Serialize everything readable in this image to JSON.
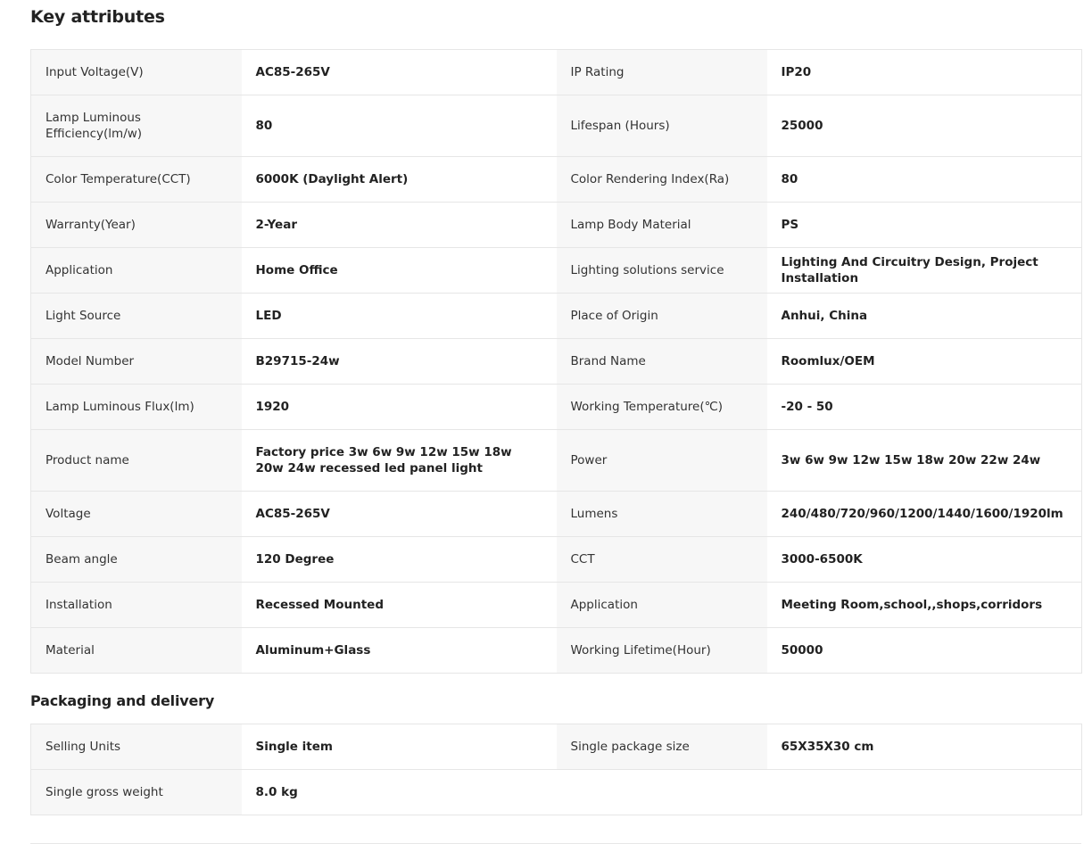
{
  "key_attributes": {
    "title": "Key attributes",
    "rows": [
      [
        {
          "k": "Input Voltage(V)",
          "v": "AC85-265V"
        },
        {
          "k": "IP Rating",
          "v": "IP20"
        }
      ],
      [
        {
          "k": "Lamp Luminous Efficiency(lm/w)",
          "v": "80"
        },
        {
          "k": "Lifespan (Hours)",
          "v": "25000"
        }
      ],
      [
        {
          "k": "Color Temperature(CCT)",
          "v": "6000K (Daylight Alert)"
        },
        {
          "k": "Color Rendering Index(Ra)",
          "v": "80"
        }
      ],
      [
        {
          "k": "Warranty(Year)",
          "v": "2-Year"
        },
        {
          "k": "Lamp Body Material",
          "v": "PS"
        }
      ],
      [
        {
          "k": "Application",
          "v": "Home Office"
        },
        {
          "k": "Lighting solutions service",
          "v": "Lighting And Circuitry Design, Project Installation"
        }
      ],
      [
        {
          "k": "Light Source",
          "v": "LED"
        },
        {
          "k": "Place of Origin",
          "v": "Anhui, China"
        }
      ],
      [
        {
          "k": "Model Number",
          "v": "B29715-24w"
        },
        {
          "k": "Brand Name",
          "v": "Roomlux/OEM"
        }
      ],
      [
        {
          "k": "Lamp Luminous Flux(lm)",
          "v": "1920"
        },
        {
          "k": "Working Temperature(℃)",
          "v": "-20 - 50"
        }
      ],
      [
        {
          "k": "Product name",
          "v": "Factory price 3w 6w 9w 12w 15w 18w 20w 24w recessed led panel light"
        },
        {
          "k": "Power",
          "v": "3w 6w 9w 12w 15w 18w 20w 22w 24w"
        }
      ],
      [
        {
          "k": "Voltage",
          "v": "AC85-265V"
        },
        {
          "k": "Lumens",
          "v": "240/480/720/960/1200/1440/1600/1920lm"
        }
      ],
      [
        {
          "k": "Beam angle",
          "v": "120 Degree"
        },
        {
          "k": "CCT",
          "v": "3000-6500K"
        }
      ],
      [
        {
          "k": "Installation",
          "v": "Recessed Mounted"
        },
        {
          "k": "Application",
          "v": "Meeting Room,school,,shops,corridors"
        }
      ],
      [
        {
          "k": "Material",
          "v": "Aluminum+Glass"
        },
        {
          "k": "Working Lifetime(Hour)",
          "v": "50000"
        }
      ]
    ]
  },
  "packaging": {
    "title": "Packaging and delivery",
    "rows": [
      [
        {
          "k": "Selling Units",
          "v": "Single item"
        },
        {
          "k": "Single package size",
          "v": "65X35X30 cm"
        }
      ],
      [
        {
          "k": "Single gross weight",
          "v": "8.0 kg"
        },
        {
          "k": "",
          "v": ""
        }
      ]
    ]
  }
}
